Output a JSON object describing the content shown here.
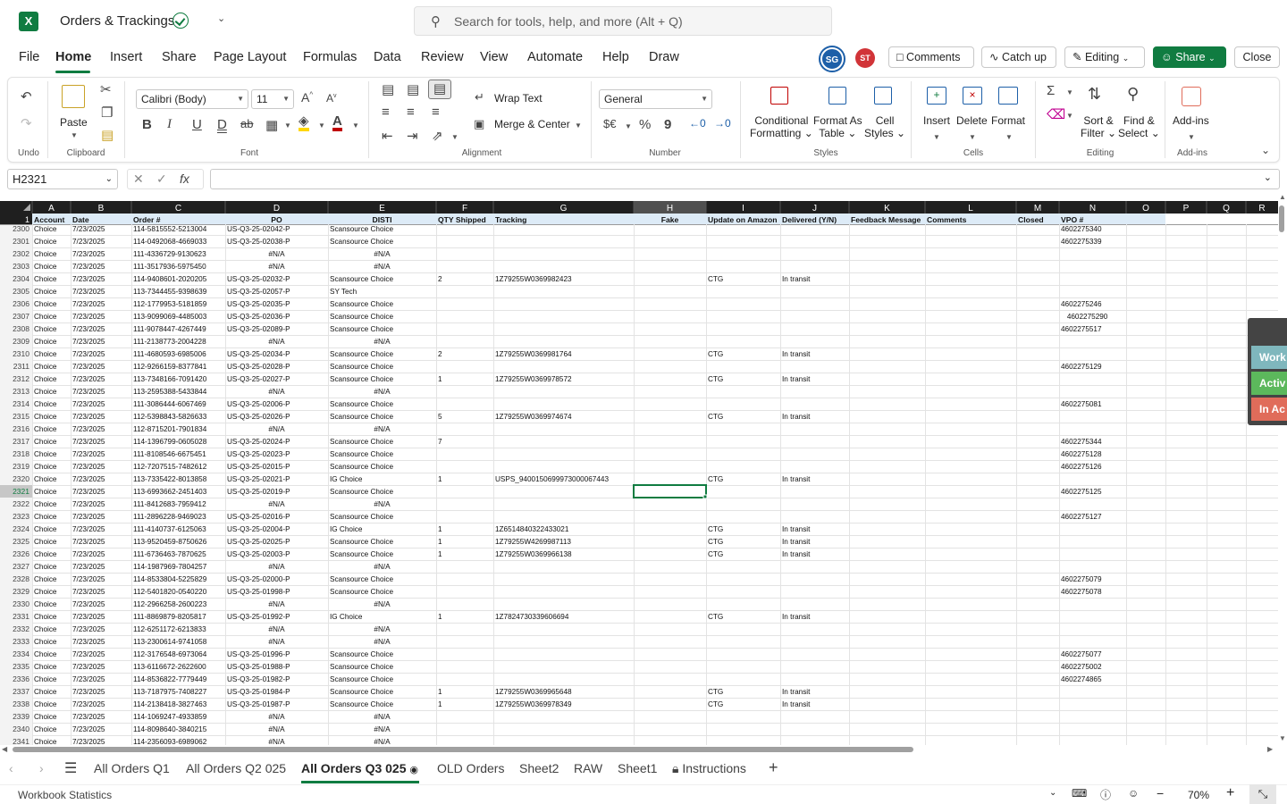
{
  "title_bar": {
    "app_icon": "X",
    "doc_title": "Orders & Trackings",
    "search_placeholder": "Search for tools, help, and more (Alt + Q)"
  },
  "menu": {
    "tabs": [
      "File",
      "Home",
      "Insert",
      "Share",
      "Page Layout",
      "Formulas",
      "Data",
      "Review",
      "View",
      "Automate",
      "Help",
      "Draw"
    ],
    "avatars": [
      "SG",
      "ST"
    ],
    "comments_label": "Comments",
    "catchup_label": "Catch up",
    "editing_label": "Editing",
    "share_label": "Share",
    "close_label": "Close"
  },
  "ribbon": {
    "groups": {
      "undo": "Undo",
      "clipboard": "Clipboard",
      "font": "Font",
      "alignment": "Alignment",
      "number": "Number",
      "styles": "Styles",
      "cells": "Cells",
      "editing": "Editing",
      "addins": "Add-ins"
    },
    "paste": "Paste",
    "font_name": "Calibri (Body)",
    "font_size": "11",
    "wrap_text": "Wrap Text",
    "merge_center": "Merge & Center",
    "number_format": "General",
    "conditional_formatting": [
      "Conditional",
      "Formatting"
    ],
    "format_as_table": [
      "Format As",
      "Table"
    ],
    "cell_styles": [
      "Cell",
      "Styles"
    ],
    "insert": "Insert",
    "delete": "Delete",
    "format": "Format",
    "sort_filter": [
      "Sort &",
      "Filter"
    ],
    "find_select": [
      "Find &",
      "Select"
    ],
    "addins": "Add-ins"
  },
  "formula_bar": {
    "name_box": "H2321",
    "formula": ""
  },
  "grid": {
    "columns": [
      "A",
      "B",
      "C",
      "D",
      "E",
      "F",
      "G",
      "H",
      "I",
      "J",
      "K",
      "L",
      "M",
      "N",
      "O",
      "P",
      "Q",
      "R"
    ],
    "headers": [
      "Account",
      "Date",
      "Order #",
      "PO",
      "DISTI",
      "QTY Shipped",
      "Tracking",
      "Fake",
      "Update on Amazon",
      "Delivered (Y/N)",
      "Feedback Message",
      "Comments",
      "Closed",
      "VPO #",
      "",
      "",
      "",
      ""
    ],
    "selected_cell": "H2321",
    "rows": [
      {
        "n": "2300",
        "c": [
          "Choice",
          "7/23/2025",
          "114-5815552-5213004",
          "US-Q3-25-02042-P",
          "Scansource Choice",
          "",
          "",
          "",
          "",
          "",
          "",
          "",
          "",
          "4602275340"
        ]
      },
      {
        "n": "2301",
        "c": [
          "Choice",
          "7/23/2025",
          "114-0492068-4669033",
          "US-Q3-25-02038-P",
          "Scansource Choice",
          "",
          "",
          "",
          "",
          "",
          "",
          "",
          "",
          "4602275339"
        ]
      },
      {
        "n": "2302",
        "c": [
          "Choice",
          "7/23/2025",
          "111-4336729-9130623",
          "#N/A",
          "#N/A",
          "",
          "",
          "",
          "",
          "",
          "",
          "",
          "",
          ""
        ]
      },
      {
        "n": "2303",
        "c": [
          "Choice",
          "7/23/2025",
          "111-3517936-5975450",
          "#N/A",
          "#N/A",
          "",
          "",
          "",
          "",
          "",
          "",
          "",
          "",
          ""
        ]
      },
      {
        "n": "2304",
        "c": [
          "Choice",
          "7/23/2025",
          "114-9408601-2020205",
          "US-Q3-25-02032-P",
          "Scansource Choice",
          "2",
          "1Z79255W0369982423",
          "",
          "CTG",
          "In transit",
          "",
          "",
          "",
          ""
        ]
      },
      {
        "n": "2305",
        "c": [
          "Choice",
          "7/23/2025",
          "113-7344455-9398639",
          "US-Q3-25-02057-P",
          "SY Tech",
          "",
          "",
          "",
          "",
          "",
          "",
          "",
          "",
          ""
        ]
      },
      {
        "n": "2306",
        "c": [
          "Choice",
          "7/23/2025",
          "112-1779953-5181859",
          "US-Q3-25-02035-P",
          "Scansource Choice",
          "",
          "",
          "",
          "",
          "",
          "",
          "",
          "",
          "4602275246"
        ]
      },
      {
        "n": "2307",
        "c": [
          "Choice",
          "7/23/2025",
          "113-9099069-4485003",
          "US-Q3-25-02036-P",
          "Scansource Choice",
          "",
          "",
          "",
          "",
          "",
          "",
          "",
          "",
          "   4602275290"
        ]
      },
      {
        "n": "2308",
        "c": [
          "Choice",
          "7/23/2025",
          "111-9078447-4267449",
          "US-Q3-25-02089-P",
          "Scansource Choice",
          "",
          "",
          "",
          "",
          "",
          "",
          "",
          "",
          "4602275517"
        ]
      },
      {
        "n": "2309",
        "c": [
          "Choice",
          "7/23/2025",
          "111-2138773-2004228",
          "#N/A",
          "#N/A",
          "",
          "",
          "",
          "",
          "",
          "",
          "",
          "",
          ""
        ]
      },
      {
        "n": "2310",
        "c": [
          "Choice",
          "7/23/2025",
          "111-4680593-6985006",
          "US-Q3-25-02034-P",
          "Scansource Choice",
          "2",
          "1Z79255W0369981764",
          "",
          "CTG",
          "In transit",
          "",
          "",
          "",
          ""
        ]
      },
      {
        "n": "2311",
        "c": [
          "Choice",
          "7/23/2025",
          "112-9266159-8377841",
          "US-Q3-25-02028-P",
          "Scansource Choice",
          "",
          "",
          "",
          "",
          "",
          "",
          "",
          "",
          "4602275129"
        ]
      },
      {
        "n": "2312",
        "c": [
          "Choice",
          "7/23/2025",
          "113-7348166-7091420",
          "US-Q3-25-02027-P",
          "Scansource Choice",
          "1",
          "1Z79255W0369978572",
          "",
          "CTG",
          "In transit",
          "",
          "",
          "",
          ""
        ]
      },
      {
        "n": "2313",
        "c": [
          "Choice",
          "7/23/2025",
          "113-2595388-5433844",
          "#N/A",
          "#N/A",
          "",
          "",
          "",
          "",
          "",
          "",
          "",
          "",
          ""
        ]
      },
      {
        "n": "2314",
        "c": [
          "Choice",
          "7/23/2025",
          "111-3086444-6067469",
          "US-Q3-25-02006-P",
          "Scansource Choice",
          "",
          "",
          "",
          "",
          "",
          "",
          "",
          "",
          "4602275081"
        ]
      },
      {
        "n": "2315",
        "c": [
          "Choice",
          "7/23/2025",
          "112-5398843-5826633",
          "US-Q3-25-02026-P",
          "Scansource Choice",
          "5",
          "1Z79255W0369974674",
          "",
          "CTG",
          "In transit",
          "",
          "",
          "",
          ""
        ]
      },
      {
        "n": "2316",
        "c": [
          "Choice",
          "7/23/2025",
          "112-8715201-7901834",
          "#N/A",
          "#N/A",
          "",
          "",
          "",
          "",
          "",
          "",
          "",
          "",
          ""
        ]
      },
      {
        "n": "2317",
        "c": [
          "Choice",
          "7/23/2025",
          "114-1396799-0605028",
          "US-Q3-25-02024-P",
          "Scansource Choice",
          "7",
          "",
          "",
          "",
          "",
          "",
          "",
          "",
          "4602275344"
        ]
      },
      {
        "n": "2318",
        "c": [
          "Choice",
          "7/23/2025",
          "111-8108546-6675451",
          "US-Q3-25-02023-P",
          "Scansource Choice",
          "",
          "",
          "",
          "",
          "",
          "",
          "",
          "",
          "4602275128"
        ]
      },
      {
        "n": "2319",
        "c": [
          "Choice",
          "7/23/2025",
          "112-7207515-7482612",
          "US-Q3-25-02015-P",
          "Scansource Choice",
          "",
          "",
          "",
          "",
          "",
          "",
          "",
          "",
          "4602275126"
        ]
      },
      {
        "n": "2320",
        "c": [
          "Choice",
          "7/23/2025",
          "113-7335422-8013858",
          "US-Q3-25-02021-P",
          "IG Choice",
          "1",
          "USPS_9400150699973000067443",
          "",
          "CTG",
          "In transit",
          "",
          "",
          "",
          ""
        ]
      },
      {
        "n": "2321",
        "c": [
          "Choice",
          "7/23/2025",
          "113-6993662-2451403",
          "US-Q3-25-02019-P",
          "Scansource Choice",
          "",
          "",
          "",
          "",
          "",
          "",
          "",
          "",
          "4602275125"
        ]
      },
      {
        "n": "2322",
        "c": [
          "Choice",
          "7/23/2025",
          "111-8412683-7959412",
          "#N/A",
          "#N/A",
          "",
          "",
          "",
          "",
          "",
          "",
          "",
          "",
          ""
        ]
      },
      {
        "n": "2323",
        "c": [
          "Choice",
          "7/23/2025",
          "111-2896228-9469023",
          "US-Q3-25-02016-P",
          "Scansource Choice",
          "",
          "",
          "",
          "",
          "",
          "",
          "",
          "",
          "4602275127"
        ]
      },
      {
        "n": "2324",
        "c": [
          "Choice",
          "7/23/2025",
          "111-4140737-6125063",
          "US-Q3-25-02004-P",
          "IG Choice",
          "1",
          "1Z6514840322433021",
          "",
          "CTG",
          "In transit",
          "",
          "",
          "",
          ""
        ]
      },
      {
        "n": "2325",
        "c": [
          "Choice",
          "7/23/2025",
          "113-9520459-8750626",
          "US-Q3-25-02025-P",
          "Scansource Choice",
          "1",
          "1Z79255W4269987113",
          "",
          "CTG",
          "In transit",
          "",
          "",
          "",
          ""
        ]
      },
      {
        "n": "2326",
        "c": [
          "Choice",
          "7/23/2025",
          "111-6736463-7870625",
          "US-Q3-25-02003-P",
          "Scansource Choice",
          "1",
          "1Z79255W0369966138",
          "",
          "CTG",
          "In transit",
          "",
          "",
          "",
          ""
        ]
      },
      {
        "n": "2327",
        "c": [
          "Choice",
          "7/23/2025",
          "114-1987969-7804257",
          "#N/A",
          "#N/A",
          "",
          "",
          "",
          "",
          "",
          "",
          "",
          "",
          ""
        ]
      },
      {
        "n": "2328",
        "c": [
          "Choice",
          "7/23/2025",
          "114-8533804-5225829",
          "US-Q3-25-02000-P",
          "Scansource Choice",
          "",
          "",
          "",
          "",
          "",
          "",
          "",
          "",
          "4602275079"
        ]
      },
      {
        "n": "2329",
        "c": [
          "Choice",
          "7/23/2025",
          "112-5401820-0540220",
          "US-Q3-25-01998-P",
          "Scansource Choice",
          "",
          "",
          "",
          "",
          "",
          "",
          "",
          "",
          "4602275078"
        ]
      },
      {
        "n": "2330",
        "c": [
          "Choice",
          "7/23/2025",
          "112-2966258-2600223",
          "#N/A",
          "#N/A",
          "",
          "",
          "",
          "",
          "",
          "",
          "",
          "",
          ""
        ]
      },
      {
        "n": "2331",
        "c": [
          "Choice",
          "7/23/2025",
          "111-8869879-8205817",
          "US-Q3-25-01992-P",
          "IG Choice",
          "1",
          "1Z7824730339606694",
          "",
          "CTG",
          "In transit",
          "",
          "",
          "",
          ""
        ]
      },
      {
        "n": "2332",
        "c": [
          "Choice",
          "7/23/2025",
          "112-6251172-6213833",
          "#N/A",
          "#N/A",
          "",
          "",
          "",
          "",
          "",
          "",
          "",
          "",
          ""
        ]
      },
      {
        "n": "2333",
        "c": [
          "Choice",
          "7/23/2025",
          "113-2300614-9741058",
          "#N/A",
          "#N/A",
          "",
          "",
          "",
          "",
          "",
          "",
          "",
          "",
          ""
        ]
      },
      {
        "n": "2334",
        "c": [
          "Choice",
          "7/23/2025",
          "112-3176548-6973064",
          "US-Q3-25-01996-P",
          "Scansource Choice",
          "",
          "",
          "",
          "",
          "",
          "",
          "",
          "",
          "4602275077"
        ]
      },
      {
        "n": "2335",
        "c": [
          "Choice",
          "7/23/2025",
          "113-6116672-2622600",
          "US-Q3-25-01988-P",
          "Scansource Choice",
          "",
          "",
          "",
          "",
          "",
          "",
          "",
          "",
          "4602275002"
        ]
      },
      {
        "n": "2336",
        "c": [
          "Choice",
          "7/23/2025",
          "114-8536822-7779449",
          "US-Q3-25-01982-P",
          "Scansource Choice",
          "",
          "",
          "",
          "",
          "",
          "",
          "",
          "",
          "4602274865"
        ]
      },
      {
        "n": "2337",
        "c": [
          "Choice",
          "7/23/2025",
          "113-7187975-7408227",
          "US-Q3-25-01984-P",
          "Scansource Choice",
          "1",
          "1Z79255W0369965648",
          "",
          "CTG",
          "In transit",
          "",
          "",
          "",
          ""
        ]
      },
      {
        "n": "2338",
        "c": [
          "Choice",
          "7/23/2025",
          "114-2138418-3827463",
          "US-Q3-25-01987-P",
          "Scansource Choice",
          "1",
          "1Z79255W0369978349",
          "",
          "CTG",
          "In transit",
          "",
          "",
          "",
          ""
        ]
      },
      {
        "n": "2339",
        "c": [
          "Choice",
          "7/23/2025",
          "114-1069247-4933859",
          "#N/A",
          "#N/A",
          "",
          "",
          "",
          "",
          "",
          "",
          "",
          "",
          ""
        ]
      },
      {
        "n": "2340",
        "c": [
          "Choice",
          "7/23/2025",
          "114-8098640-3840215",
          "#N/A",
          "#N/A",
          "",
          "",
          "",
          "",
          "",
          "",
          "",
          "",
          ""
        ]
      },
      {
        "n": "2341",
        "c": [
          "Choice",
          "7/23/2025",
          "114-2356093-6989062",
          "#N/A",
          "#N/A",
          "",
          "",
          "",
          "",
          "",
          "",
          "",
          "",
          ""
        ]
      }
    ]
  },
  "side_panel": [
    "Work",
    "Activ",
    "In Ac"
  ],
  "side_panel_colors": [
    "#7fb7bd",
    "#5cb85c",
    "#e06c5a"
  ],
  "sheet_tabs": {
    "tabs": [
      "All Orders Q1",
      "All Orders Q2 025",
      "All Orders Q3 025",
      "OLD Orders",
      "Sheet2",
      "RAW",
      "Sheet1",
      "Instructions"
    ],
    "active": "All Orders Q3 025"
  },
  "status_bar": {
    "workbook_statistics": "Workbook Statistics",
    "zoom": "70%"
  },
  "colors": {
    "accent": "#107c41",
    "header_bg": "#1f1f1f",
    "row_header_bg": "#f3f3f3",
    "header_row_fill": "#ddebf7"
  }
}
